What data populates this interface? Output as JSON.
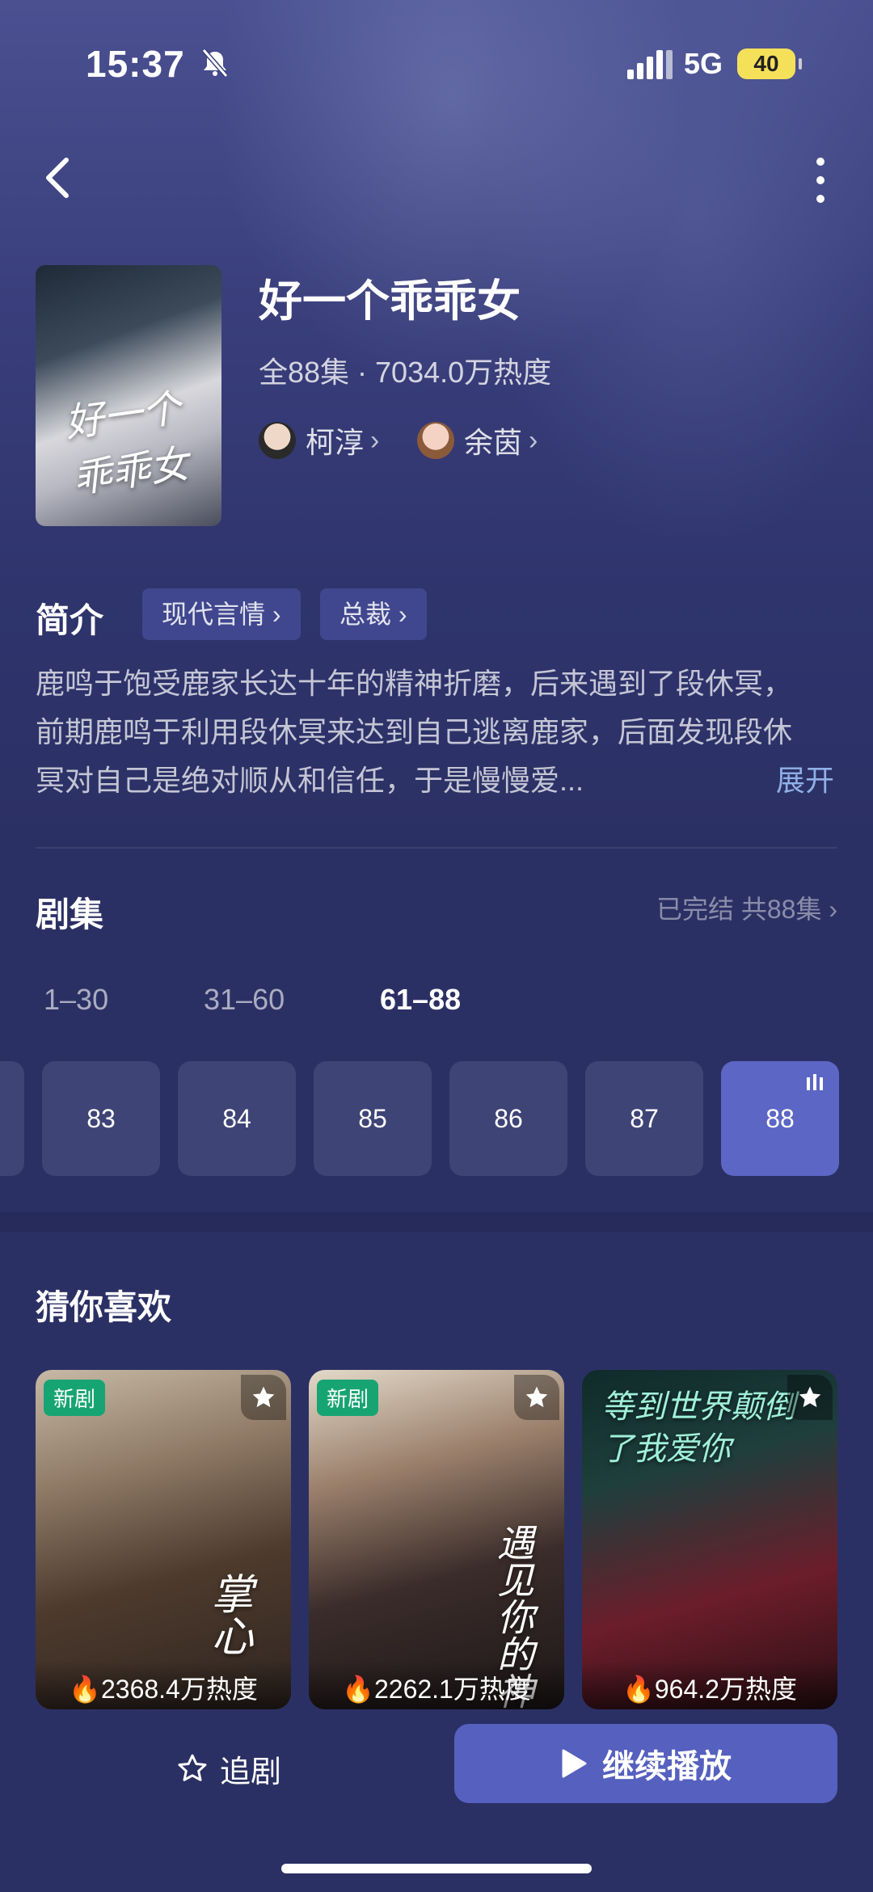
{
  "status_bar": {
    "time": "15:37",
    "network": "5G",
    "battery": "40"
  },
  "drama": {
    "title": "好一个乖乖女",
    "meta": "全88集 · 7034.0万热度",
    "poster_text": "好一个乖乖女",
    "actors": [
      {
        "name": "柯淳"
      },
      {
        "name": "余茵"
      }
    ]
  },
  "intro": {
    "heading": "简介",
    "tags": [
      "现代言情",
      "总裁"
    ],
    "description": "鹿鸣于饱受鹿家长达十年的精神折磨，后来遇到了段休冥，前期鹿鸣于利用段休冥来达到自己逃离鹿家，后面发现段休冥对自己是绝对顺从和信任，于是慢慢爱...",
    "expand_label": "展开"
  },
  "episodes": {
    "heading": "剧集",
    "status": "已完结 共88集",
    "ranges": [
      "1–30",
      "31–60",
      "61–88"
    ],
    "active_range": "61–88",
    "items": [
      "83",
      "84",
      "85",
      "86",
      "87",
      "88"
    ],
    "current": "88"
  },
  "recommend": {
    "heading": "猜你喜欢",
    "cards": [
      {
        "badge": "新剧",
        "heat": "2368.4万热度",
        "art_text": "掌心"
      },
      {
        "badge": "新剧",
        "heat": "2262.1万热度",
        "art_text": "遇见你的神"
      },
      {
        "badge": "",
        "heat": "964.2万热度",
        "art_text": "等到世界颠倒了我爱你"
      }
    ]
  },
  "bottom_bar": {
    "follow_label": "追剧",
    "play_label": "继续播放"
  },
  "colors": {
    "background": "#2b3064",
    "accent": "#5560bf",
    "episode_tile": "#3f4477",
    "link": "#8fb0e6",
    "badge_new": "#17a473"
  }
}
